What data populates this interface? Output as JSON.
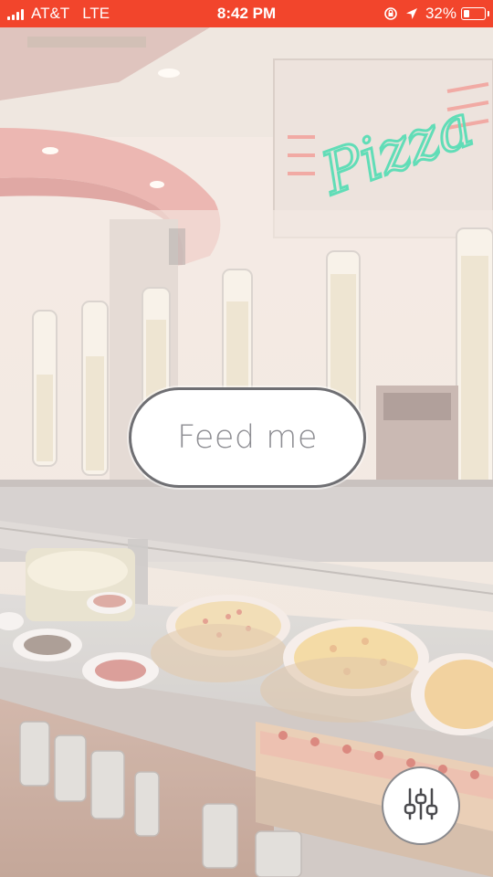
{
  "status_bar": {
    "carrier": "AT&T",
    "network": "LTE",
    "time": "8:42 PM",
    "battery_percent": "32%",
    "battery_level": 0.32,
    "icons": [
      "signal-icon",
      "orientation-lock-icon",
      "location-arrow-icon",
      "battery-icon"
    ],
    "color": "#f2452c"
  },
  "background": {
    "sign_text": "Pizza",
    "sign_color": "#3fd6a8"
  },
  "main": {
    "feed_button_label": "Feed me"
  },
  "controls": {
    "filter_icon": "sliders-icon"
  }
}
